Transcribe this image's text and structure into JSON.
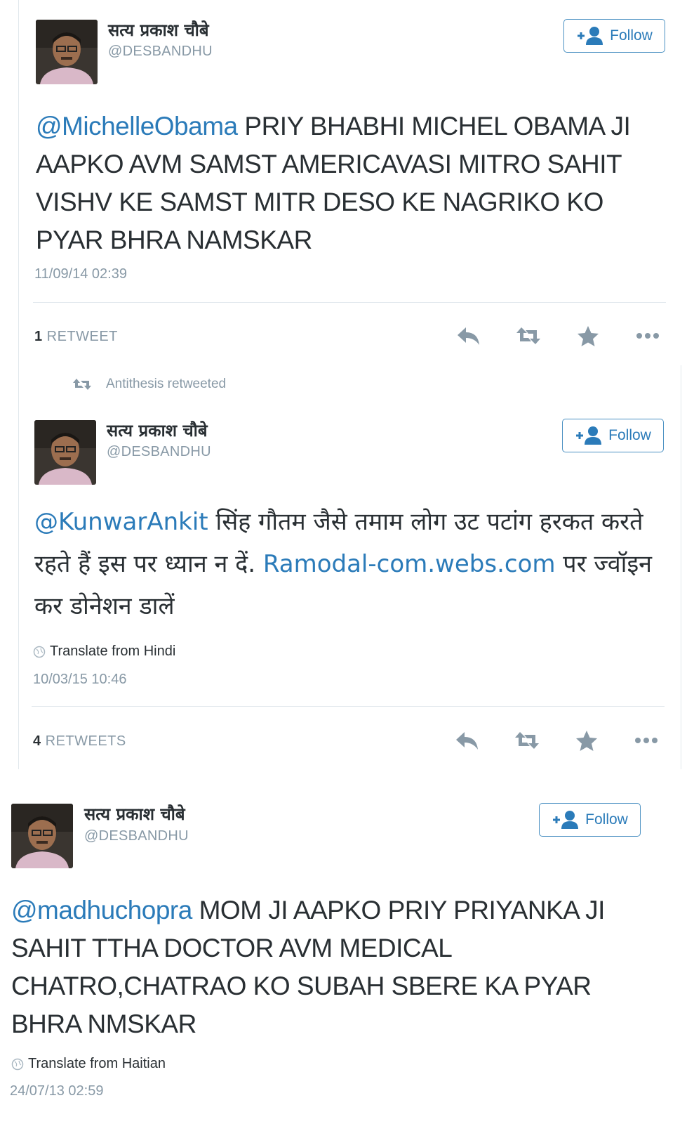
{
  "colors": {
    "link": "#2b7bb9",
    "muted": "#8899a6",
    "text": "#292f33",
    "action_icon": "#8899a6",
    "divider": "#e1e8ed"
  },
  "icons": {
    "follow": "add-user-icon",
    "reply": "reply-icon",
    "retweet": "retweet-icon",
    "favorite": "star-icon",
    "more": "more-icon",
    "translate": "globe-icon"
  },
  "tweets": [
    {
      "author_name": "सत्य प्रकाश चौबे",
      "author_handle": "@DESBANDHU",
      "follow_label": "Follow",
      "mention": "@MichelleObama",
      "body": " PRIY BHABHI MICHEL OBAMA JI AAPKO AVM SAMST AMERICAVASI MITRO SAHIT VISHV KE SAMST MITR DESO KE NAGRIKO KO PYAR BHRA NAMSKAR",
      "timestamp": "11/09/14 02:39",
      "retweet_count": "1",
      "retweet_label": "RETWEET"
    },
    {
      "context_label": "Antithesis retweeted",
      "author_name": "सत्य प्रकाश चौबे",
      "author_handle": "@DESBANDHU",
      "follow_label": "Follow",
      "mention": "@KunwarAnkit",
      "body": " सिंह गौतम जैसे तमाम लोग उट पटांग हरकत करते रहते हैं इस पर ध्यान न दें. ",
      "link": "Ramodal-com.webs.com",
      "body_after": " पर ज्वॉइन कर डोनेशन डालें",
      "translate_label": "Translate from Hindi",
      "timestamp": "10/03/15 10:46",
      "retweet_count": "4",
      "retweet_label": "RETWEETS"
    },
    {
      "author_name": "सत्य प्रकाश चौबे",
      "author_handle": "@DESBANDHU",
      "follow_label": "Follow",
      "mention": "@madhuchopra",
      "body": " MOM JI AAPKO PRIY PRIYANKA JI SAHIT TTHA DOCTOR AVM MEDICAL CHATRO,CHATRAO KO SUBAH SBERE KA PYAR BHRA NMSKAR",
      "translate_label": "Translate from Haitian",
      "timestamp": "24/07/13 02:59"
    }
  ]
}
